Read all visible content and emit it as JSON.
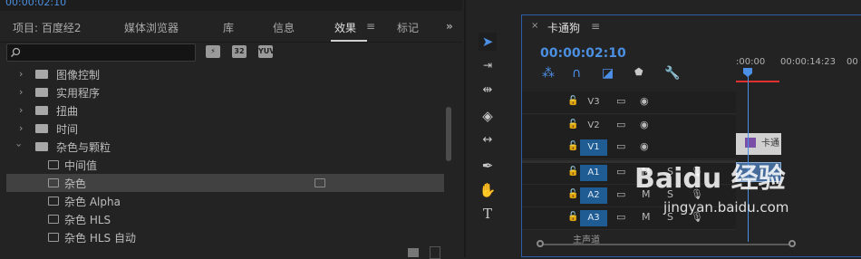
{
  "top": {
    "timecode": "00:00:02:10"
  },
  "tabs": [
    "项目: 百度经2",
    "媒体浏览器",
    "库",
    "信息",
    "效果",
    "标记"
  ],
  "tabs_more": "»",
  "effects_menu": "≡",
  "search": {
    "placeholder": ""
  },
  "filter_icons": [
    "加速",
    "32",
    "YUV"
  ],
  "tree": [
    {
      "label": "图像控制",
      "type": "folder",
      "expanded": false
    },
    {
      "label": "实用程序",
      "type": "folder",
      "expanded": false
    },
    {
      "label": "扭曲",
      "type": "folder",
      "expanded": false
    },
    {
      "label": "时间",
      "type": "folder",
      "expanded": false
    },
    {
      "label": "杂色与颗粒",
      "type": "folder",
      "expanded": true
    },
    {
      "label": "中间值",
      "type": "effect"
    },
    {
      "label": "杂色",
      "type": "effect",
      "selected": true
    },
    {
      "label": "杂色 Alpha",
      "type": "effect"
    },
    {
      "label": "杂色 HLS",
      "type": "effect"
    },
    {
      "label": "杂色 HLS 自动",
      "type": "effect"
    }
  ],
  "tools": [
    "selection-tool",
    "track-select-tool",
    "ripple-edit-tool",
    "razor-tool",
    "slip-tool",
    "pen-tool",
    "hand-tool",
    "type-tool"
  ],
  "timeline": {
    "close": "×",
    "title": "卡通狗",
    "menu": "≡",
    "timecode": "00:00:02:10",
    "ruler": [
      ":00:00",
      "00:00:14:23",
      "00"
    ],
    "tracks": [
      {
        "name": "V3",
        "targeted": false,
        "kind": "video"
      },
      {
        "name": "V2",
        "targeted": false,
        "kind": "video"
      },
      {
        "name": "V1",
        "targeted": true,
        "kind": "video"
      },
      {
        "name": "A1",
        "targeted": true,
        "kind": "audio"
      },
      {
        "name": "A2",
        "targeted": true,
        "kind": "audio"
      },
      {
        "name": "A3",
        "targeted": true,
        "kind": "audio"
      }
    ],
    "audio_m": "M",
    "audio_s": "S",
    "clip_v1_label": "卡通",
    "master_label": "主声道"
  },
  "watermark": {
    "logo": "Baidu 经验",
    "url": "jingyan.baidu.com"
  }
}
